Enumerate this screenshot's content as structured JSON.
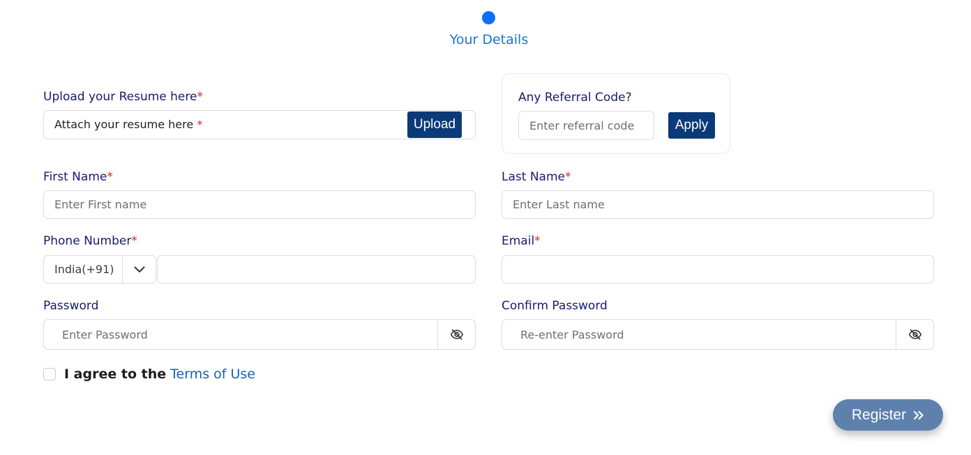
{
  "step": {
    "title": "Your Details"
  },
  "resume": {
    "label": "Upload your Resume here",
    "required_mark": "*",
    "attach_text": "Attach your resume here",
    "attach_required_mark": "*",
    "upload_label": "Upload"
  },
  "referral": {
    "label": "Any Referral Code?",
    "placeholder": "Enter referral code",
    "apply_label": "Apply"
  },
  "first_name": {
    "label": "First Name",
    "required_mark": "*",
    "placeholder": "Enter First name"
  },
  "last_name": {
    "label": "Last Name",
    "required_mark": "*",
    "placeholder": "Enter Last name"
  },
  "phone": {
    "label": "Phone Number",
    "required_mark": "*",
    "country": "India(+91)",
    "dropdown_icon": "chevron-down-icon",
    "value": ""
  },
  "email": {
    "label": "Email",
    "required_mark": "*",
    "value": ""
  },
  "password": {
    "label": "Password",
    "placeholder": "Enter Password",
    "toggle_icon": "eye-off-icon"
  },
  "confirm_password": {
    "label": "Confirm Password",
    "placeholder": "Re-enter Password",
    "toggle_icon": "eye-off-icon"
  },
  "terms": {
    "prefix": "I agree to the",
    "link_text": "Terms of Use",
    "checked": false
  },
  "register": {
    "label": "Register",
    "icon": "double-chevron-right-icon"
  },
  "colors": {
    "accent": "#0d6efd",
    "navy": "#0b3a78",
    "label": "#171a6e",
    "required": "#e0222a",
    "register_bg": "#5e80ad"
  }
}
